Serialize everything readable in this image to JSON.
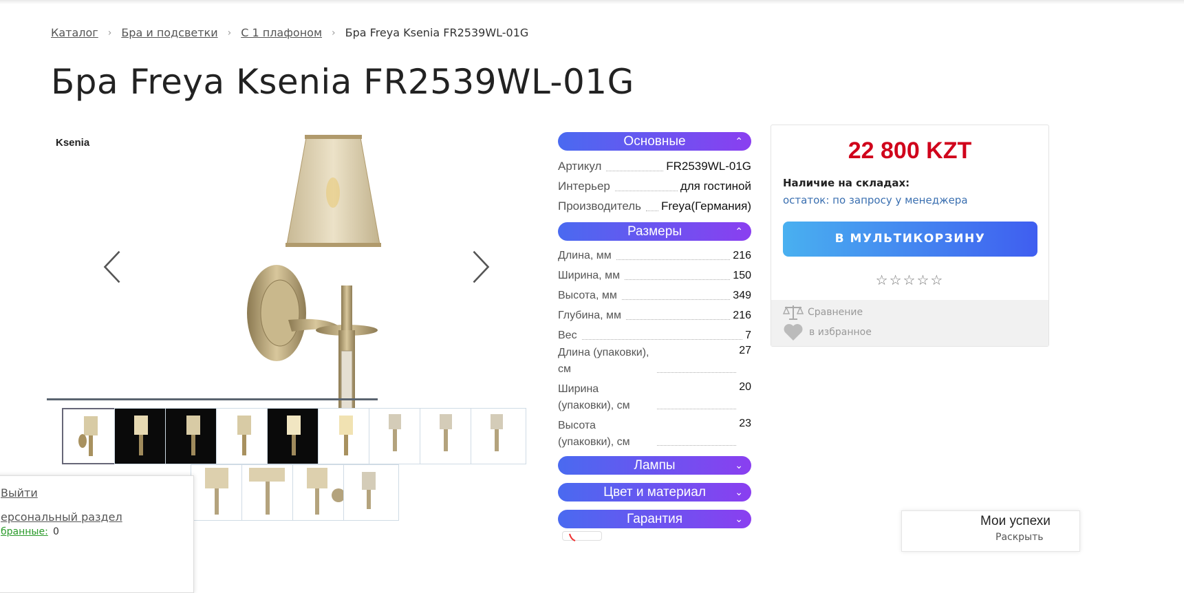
{
  "breadcrumb": {
    "items": [
      "Каталог",
      "Бра и подсветки",
      "С 1 плафоном"
    ],
    "current": "Бра Freya Ksenia FR2539WL-01G"
  },
  "product": {
    "title": "Бра Freya Ksenia FR2539WL-01G",
    "brand": "Ksenia"
  },
  "specs": {
    "basic": {
      "title": "Основные",
      "rows": [
        {
          "k": "Артикул",
          "v": "FR2539WL-01G"
        },
        {
          "k": "Интерьер",
          "v": "для гостиной"
        },
        {
          "k": "Производитель",
          "v": "Freya(Германия)"
        }
      ]
    },
    "sizes": {
      "title": "Размеры",
      "rows": [
        {
          "k": "Длина, мм",
          "v": "216"
        },
        {
          "k": "Ширина, мм",
          "v": "150"
        },
        {
          "k": "Высота, мм",
          "v": "349"
        },
        {
          "k": "Глубина, мм",
          "v": "216"
        },
        {
          "k": "Вес",
          "v": "7"
        },
        {
          "k": "Длина (упаковки), см",
          "v": "27"
        },
        {
          "k": "Ширина (упаковки), см",
          "v": "20"
        },
        {
          "k": "Высота (упаковки), см",
          "v": "23"
        }
      ]
    },
    "lamps": {
      "title": "Лампы"
    },
    "color": {
      "title": "Цвет и материал"
    },
    "warranty": {
      "title": "Гарантия"
    }
  },
  "buy": {
    "price": "22 800 KZT",
    "stock_label": "Наличие на складах:",
    "stock_value": "остаток: по запросу у менеджера",
    "cart_button": "В МУЛЬТИКОРЗИНУ",
    "stars": "☆☆☆☆☆",
    "compare": "Сравнение",
    "favorite": "в избранное"
  },
  "user_panel": {
    "logout": "Выйти",
    "personal": "ерсональный раздел",
    "favorites_label": "бранные:",
    "favorites_count": "0"
  },
  "achievements": {
    "title": "Мои успехи",
    "toggle": "Раскрыть"
  },
  "colors": {
    "price": "#d0021b",
    "accent_from": "#4a6af0",
    "accent_to": "#8a3ff0",
    "button_from": "#49b0f0",
    "button_to": "#3f5ef0",
    "link": "#3a6fb0"
  }
}
